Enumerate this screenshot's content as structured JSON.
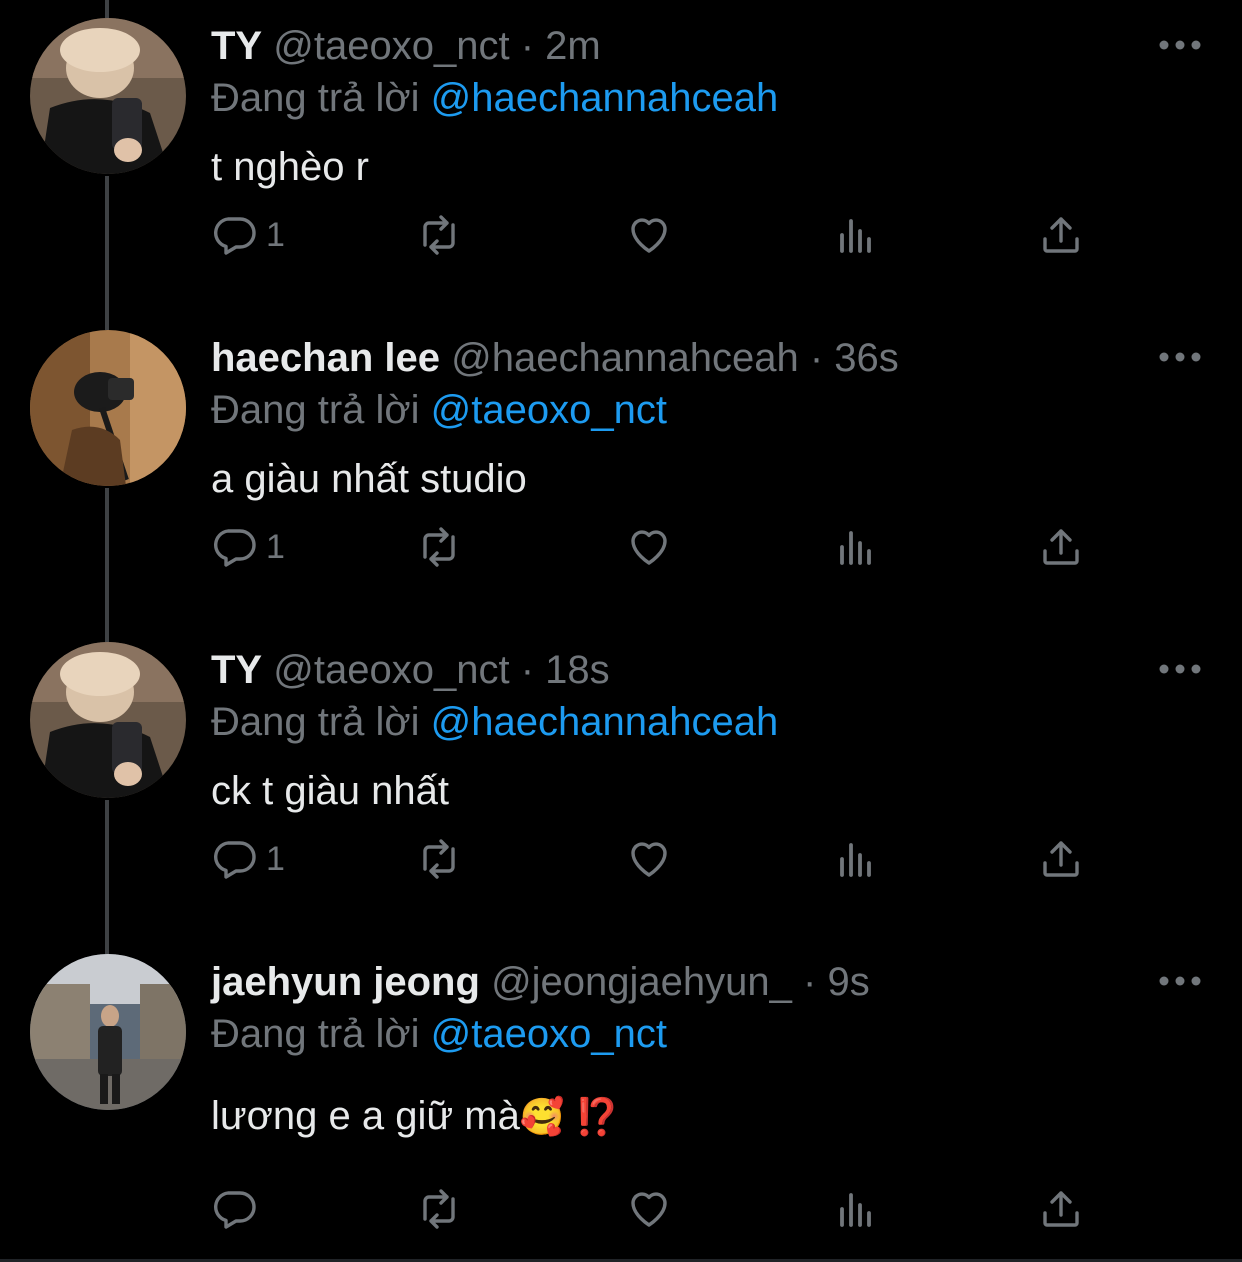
{
  "tweets": [
    {
      "name": "TY",
      "handle": "@taeoxo_nct",
      "time": "2m",
      "reply_prefix": "Đang trả lời",
      "reply_to": "@haechannahceah",
      "text": "t nghèo r",
      "emoji": "",
      "reply_count": "1",
      "avatar": "ty-avatar"
    },
    {
      "name": "haechan lee",
      "handle": "@haechannahceah",
      "time": "36s",
      "reply_prefix": "Đang trả lời",
      "reply_to": "@taeoxo_nct",
      "text": "a giàu nhất studio",
      "emoji": "",
      "reply_count": "1",
      "avatar": "haechan-avatar"
    },
    {
      "name": "TY",
      "handle": "@taeoxo_nct",
      "time": "18s",
      "reply_prefix": "Đang trả lời",
      "reply_to": "@haechannahceah",
      "text": "ck t giàu nhất",
      "emoji": "",
      "reply_count": "1",
      "avatar": "ty-avatar"
    },
    {
      "name": "jaehyun jeong",
      "handle": "@jeongjaehyun_",
      "time": "9s",
      "reply_prefix": "Đang trả lời",
      "reply_to": "@taeoxo_nct",
      "text": "lương e a giữ mà",
      "emoji": "🥰 ⁉️",
      "reply_count": "",
      "avatar": "jaehyun-avatar"
    }
  ],
  "icons": {
    "reply": "reply-icon",
    "retweet": "retweet-icon",
    "like": "like-icon",
    "views": "views-icon",
    "share": "share-icon",
    "more": "more-icon"
  },
  "colors": {
    "background": "#000000",
    "text": "#e7e9ea",
    "muted": "#71767b",
    "link": "#1d9bf0",
    "thread_line": "#3e4144"
  }
}
